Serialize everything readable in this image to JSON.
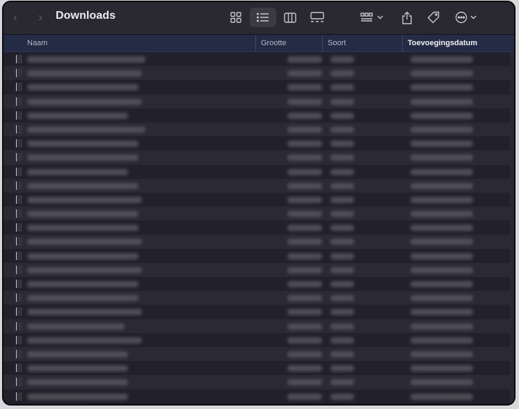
{
  "window": {
    "title": "Downloads",
    "back_icon": "chevron-left-icon",
    "forward_icon": "chevron-right-icon"
  },
  "toolbar": {
    "view_modes": [
      "icon-view",
      "list-view",
      "column-view",
      "gallery-view"
    ],
    "active_view": "list-view",
    "group_icon": "group-grid-icon",
    "share_icon": "share-icon",
    "tag_icon": "tag-icon",
    "more_icon": "ellipsis-circle-icon"
  },
  "columns": {
    "name": "Naam",
    "size": "Grootte",
    "kind": "Soort",
    "date_added": "Toevoegingsdatum"
  },
  "list": {
    "visible_row_count": 25,
    "contents": "blurred"
  },
  "colors": {
    "window_bg": "#1f1d25",
    "header_bg": "#232b45",
    "row_alt": "#2b2933"
  }
}
